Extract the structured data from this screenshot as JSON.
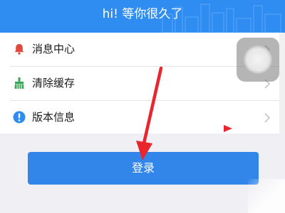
{
  "header": {
    "title": "hi! 等你很久了",
    "background_color": "#2f8df2"
  },
  "menu": {
    "items": [
      {
        "label": "消息中心",
        "icon": "bell-icon",
        "icon_color": "#e0483b"
      },
      {
        "label": "清除缓存",
        "icon": "broom-icon",
        "icon_color": "#3aa758"
      },
      {
        "label": "版本信息",
        "icon": "info-icon",
        "icon_color": "#2f8df2"
      }
    ]
  },
  "login_button": {
    "label": "登录",
    "color": "#3286ea"
  },
  "colors": {
    "annotation_arrow": "#e8262e"
  }
}
